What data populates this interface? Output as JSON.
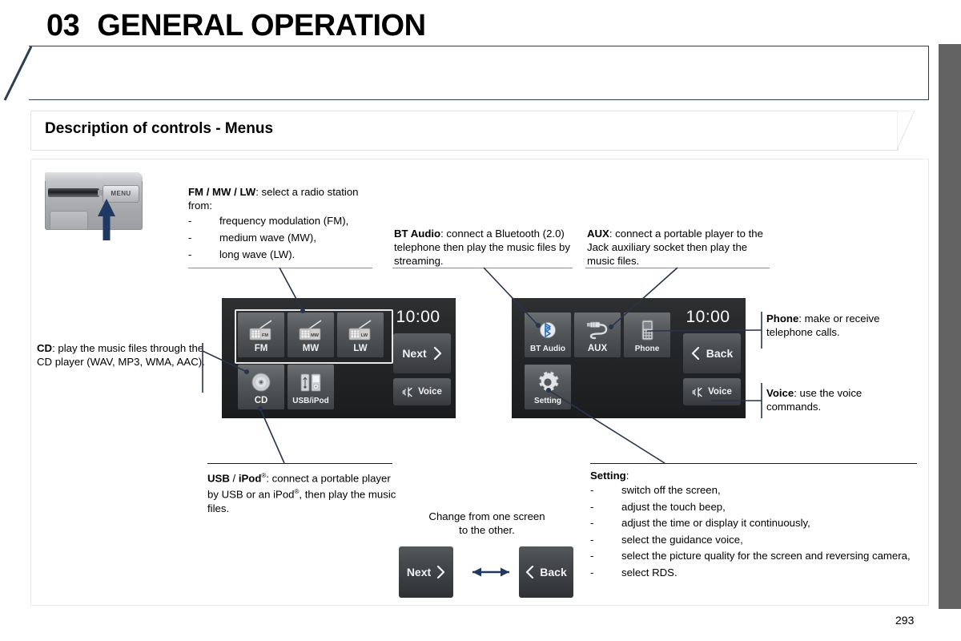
{
  "chapter": {
    "number": "03",
    "title": "GENERAL OPERATION"
  },
  "section": {
    "title": "Description of controls - Menus"
  },
  "hardware": {
    "menu_button_label": "MENU"
  },
  "callouts": {
    "radio": {
      "term": "FM / MW / LW",
      "intro": ": select a radio station from:",
      "items": [
        "frequency modulation (FM),",
        "medium wave (MW),",
        "long wave (LW)."
      ]
    },
    "bt_audio": {
      "term": "BT Audio",
      "text": ": connect a Bluetooth (2.0) telephone then play the music files by streaming."
    },
    "aux": {
      "term": "AUX",
      "text": ": connect a portable player to the Jack auxiliary socket then play the music files."
    },
    "cd": {
      "term": "CD",
      "text": ": play the music files through the CD player (WAV, MP3, WMA, AAC)."
    },
    "phone": {
      "term": "Phone",
      "text": ": make or receive telephone calls."
    },
    "voice": {
      "term": "Voice",
      "text": ": use the voice commands."
    },
    "usb_ipod": {
      "term_a": "USB",
      "sep": " / ",
      "term_b": "iPod",
      "sup_b": "®",
      "text_1": ": connect a portable player by USB or an iPod",
      "sup_2": "®",
      "text_2": ", then play the music files."
    },
    "setting": {
      "term": "Setting",
      "colon": ":",
      "items": [
        "switch off the screen,",
        "adjust the touch beep,",
        "adjust the time or display it continuously,",
        "select the guidance voice,",
        "select the picture quality for the screen and reversing camera,",
        "select RDS."
      ]
    }
  },
  "screen_left": {
    "clock": "10:00",
    "tiles": [
      {
        "label": "FM",
        "icon": "radio-fm-icon",
        "badge": "FM"
      },
      {
        "label": "MW",
        "icon": "radio-mw-icon",
        "badge": "MW"
      },
      {
        "label": "LW",
        "icon": "radio-lw-icon",
        "badge": "LW"
      },
      {
        "label": "CD",
        "icon": "cd-disc-icon",
        "badge": ""
      },
      {
        "label": "USB/iPod",
        "icon": "usb-ipod-icon",
        "badge": ""
      }
    ],
    "next_label": "Next",
    "next_icon": "chevron-right-icon",
    "voice_label": "Voice",
    "voice_icon": "voice-wave-icon"
  },
  "screen_right": {
    "clock": "10:00",
    "tiles": [
      {
        "label": "BT Audio",
        "icon": "bluetooth-icon"
      },
      {
        "label": "AUX",
        "icon": "aux-jack-icon"
      },
      {
        "label": "Phone",
        "icon": "mobile-phone-icon"
      },
      {
        "label": "Setting",
        "icon": "gear-icon"
      }
    ],
    "back_label": "Back",
    "back_icon": "chevron-left-icon",
    "voice_label": "Voice",
    "voice_icon": "voice-wave-icon"
  },
  "switcher": {
    "caption_line1": "Change from one screen",
    "caption_line2": "to the other.",
    "next_label": "Next",
    "back_label": "Back",
    "arrow_icon": "double-arrow-icon"
  },
  "footer": {
    "page_number": "293"
  },
  "colors": {
    "banner_border": "#2c3e54",
    "leader_line": "#26344c",
    "chapter_tab": "#636363",
    "arrow_blue": "#1f3864"
  }
}
